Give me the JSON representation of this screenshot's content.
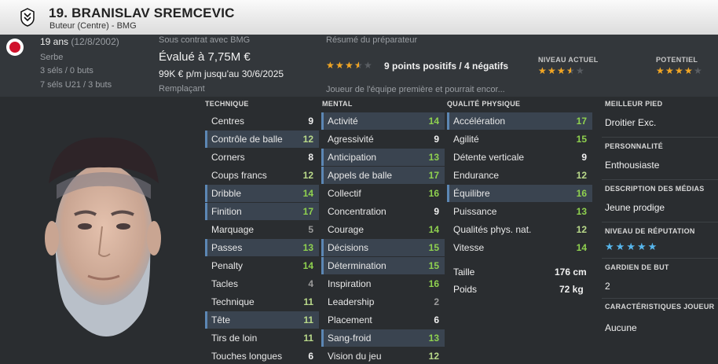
{
  "header": {
    "name": "19. BRANISLAV SREMCEVIC",
    "position_club": "Buteur (Centre) - BMG"
  },
  "info": {
    "age": "19 ans",
    "dob": "(12/8/2002)",
    "nationality": "Serbe",
    "caps": "3 séls / 0 buts",
    "u21_caps": "7 séls U21 / 3 buts",
    "contract_label": "Sous contrat avec BMG",
    "value": "Évalué à 7,75M €",
    "wage": "99K € p/m jusqu'au 30/6/2025",
    "status": "Remplaçant",
    "report_label": "Résumé du préparateur",
    "report_summary": "9 points positifs / 4 négatifs",
    "report_rating": 3.5,
    "report_text": "Joueur de l'équipe première et pourrait encor...",
    "current_ability_label": "NIVEAU ACTUEL",
    "current_ability": 3.5,
    "potential_label": "POTENTIEL",
    "potential": 4.0
  },
  "technique": {
    "title": "TECHNIQUE",
    "attrs": [
      {
        "name": "Centres",
        "value": "9",
        "hl": false,
        "color": "white"
      },
      {
        "name": "Contrôle de balle",
        "value": "12",
        "hl": true,
        "color": "lgreen"
      },
      {
        "name": "Corners",
        "value": "8",
        "hl": false,
        "color": "white"
      },
      {
        "name": "Coups francs",
        "value": "12",
        "hl": false,
        "color": "lgreen"
      },
      {
        "name": "Dribble",
        "value": "14",
        "hl": true,
        "color": "green"
      },
      {
        "name": "Finition",
        "value": "17",
        "hl": true,
        "color": "green"
      },
      {
        "name": "Marquage",
        "value": "5",
        "hl": false,
        "color": "grey"
      },
      {
        "name": "Passes",
        "value": "13",
        "hl": true,
        "color": "green"
      },
      {
        "name": "Penalty",
        "value": "14",
        "hl": false,
        "color": "green"
      },
      {
        "name": "Tacles",
        "value": "4",
        "hl": false,
        "color": "grey"
      },
      {
        "name": "Technique",
        "value": "11",
        "hl": false,
        "color": "lgreen"
      },
      {
        "name": "Tête",
        "value": "11",
        "hl": true,
        "color": "lgreen"
      },
      {
        "name": "Tirs de loin",
        "value": "11",
        "hl": false,
        "color": "lgreen"
      },
      {
        "name": "Touches longues",
        "value": "6",
        "hl": false,
        "color": "white"
      }
    ]
  },
  "mental": {
    "title": "MENTAL",
    "attrs": [
      {
        "name": "Activité",
        "value": "14",
        "hl": true,
        "color": "green"
      },
      {
        "name": "Agressivité",
        "value": "9",
        "hl": false,
        "color": "white"
      },
      {
        "name": "Anticipation",
        "value": "13",
        "hl": true,
        "color": "green"
      },
      {
        "name": "Appels de balle",
        "value": "17",
        "hl": true,
        "color": "green"
      },
      {
        "name": "Collectif",
        "value": "16",
        "hl": false,
        "color": "green"
      },
      {
        "name": "Concentration",
        "value": "9",
        "hl": false,
        "color": "white"
      },
      {
        "name": "Courage",
        "value": "14",
        "hl": false,
        "color": "green"
      },
      {
        "name": "Décisions",
        "value": "15",
        "hl": true,
        "color": "green"
      },
      {
        "name": "Détermination",
        "value": "15",
        "hl": true,
        "color": "green"
      },
      {
        "name": "Inspiration",
        "value": "16",
        "hl": false,
        "color": "green"
      },
      {
        "name": "Leadership",
        "value": "2",
        "hl": false,
        "color": "grey"
      },
      {
        "name": "Placement",
        "value": "6",
        "hl": false,
        "color": "white"
      },
      {
        "name": "Sang-froid",
        "value": "13",
        "hl": true,
        "color": "green"
      },
      {
        "name": "Vision du jeu",
        "value": "12",
        "hl": false,
        "color": "lgreen"
      }
    ]
  },
  "physical": {
    "title": "QUALITÉ PHYSIQUE",
    "attrs": [
      {
        "name": "Accélération",
        "value": "17",
        "hl": true,
        "color": "green"
      },
      {
        "name": "Agilité",
        "value": "15",
        "hl": false,
        "color": "green"
      },
      {
        "name": "Détente verticale",
        "value": "9",
        "hl": false,
        "color": "white"
      },
      {
        "name": "Endurance",
        "value": "12",
        "hl": false,
        "color": "lgreen"
      },
      {
        "name": "Équilibre",
        "value": "16",
        "hl": true,
        "color": "green"
      },
      {
        "name": "Puissance",
        "value": "13",
        "hl": false,
        "color": "green"
      },
      {
        "name": "Qualités phys. nat.",
        "value": "12",
        "hl": false,
        "color": "lgreen"
      },
      {
        "name": "Vitesse",
        "value": "14",
        "hl": false,
        "color": "green"
      }
    ],
    "height_label": "Taille",
    "height": "176 cm",
    "weight_label": "Poids",
    "weight": "72 kg"
  },
  "side": {
    "foot_label": "MEILLEUR PIED",
    "foot": "Droitier Exc.",
    "personality_label": "PERSONNALITÉ",
    "personality": "Enthousiaste",
    "media_label": "DESCRIPTION DES MÉDIAS",
    "media": "Jeune prodige",
    "reputation_label": "NIVEAU DE RÉPUTATION",
    "reputation": 5,
    "gk_label": "GARDIEN DE BUT",
    "gk": "2",
    "traits_label": "CARACTÉRISTIQUES JOUEUR",
    "traits": "Aucune"
  },
  "colors": {
    "green": "#8fd14f",
    "lgreen": "#b9d98a",
    "white": "#f0f0f0",
    "grey": "#9b9b9b",
    "highlight": "#3a4450",
    "star": "#f3a622",
    "rep_star": "#57b6ec"
  }
}
